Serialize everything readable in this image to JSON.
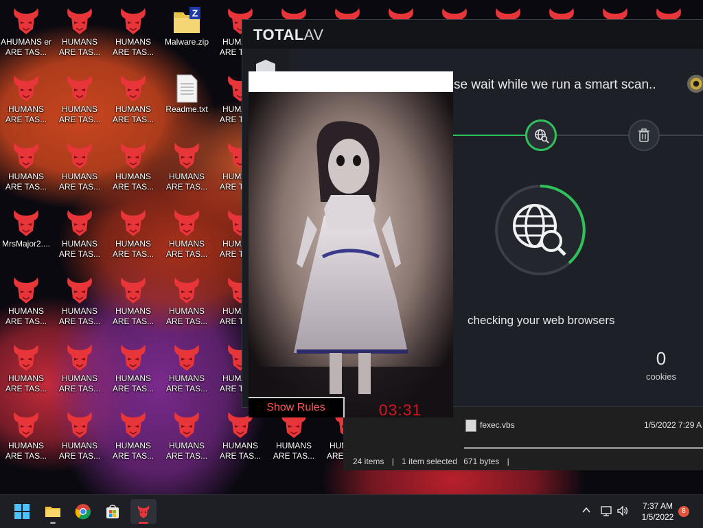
{
  "desktop": {
    "icons": [
      {
        "label": "AHUMANS er ARE TAS...",
        "kind": "demon-overlay"
      },
      {
        "label": "HUMANS ARE TAS...",
        "kind": "demon"
      },
      {
        "label": "HUMANS ARE TAS...",
        "kind": "demon"
      },
      {
        "label": "Malware.zip",
        "kind": "zip"
      },
      {
        "label": "HUMANS ARE TAS...",
        "kind": "demon"
      },
      {
        "label": "HUMANS ARE TAS...",
        "kind": "demon"
      },
      {
        "label": "HUMANS ARE TAS...",
        "kind": "demon"
      },
      {
        "label": "HUMANS ARE TAS...",
        "kind": "demon"
      },
      {
        "label": "Readme.txt",
        "kind": "text"
      },
      {
        "label": "HUMANS ARE TAS...",
        "kind": "demon"
      },
      {
        "label": "HUMANS ARE TAS...",
        "kind": "demon"
      },
      {
        "label": "HUMANS ARE TAS...",
        "kind": "demon"
      },
      {
        "label": "HUMANS ARE TAS...",
        "kind": "demon"
      },
      {
        "label": "HUMANS ARE TAS...",
        "kind": "demon"
      },
      {
        "label": "HUMANS ARE TAS...",
        "kind": "demon"
      },
      {
        "label": "MrsMajor2....",
        "kind": "demon"
      },
      {
        "label": "HUMANS ARE TAS...",
        "kind": "demon"
      },
      {
        "label": "HUMANS ARE TAS...",
        "kind": "demon"
      },
      {
        "label": "HUMANS ARE TAS...",
        "kind": "demon"
      },
      {
        "label": "HUMANS ARE TAS...",
        "kind": "demon"
      },
      {
        "label": "HUMANS ARE TAS...",
        "kind": "demon"
      },
      {
        "label": "HUMANS ARE TAS...",
        "kind": "demon"
      },
      {
        "label": "HUMANS ARE TAS...",
        "kind": "demon"
      },
      {
        "label": "HUMANS ARE TAS...",
        "kind": "demon"
      },
      {
        "label": "HUMANS ARE TAS...",
        "kind": "demon"
      },
      {
        "label": "HUMANS ARE TAS...",
        "kind": "demon"
      },
      {
        "label": "HUMANS ARE TAS...",
        "kind": "demon"
      },
      {
        "label": "HUMANS ARE TAS...",
        "kind": "demon"
      },
      {
        "label": "HUMANS ARE TAS...",
        "kind": "demon"
      },
      {
        "label": "HUMANS ARE TAS...",
        "kind": "demon"
      },
      {
        "label": "HUMANS ARE TAS...",
        "kind": "demon"
      },
      {
        "label": "HUMANS ARE TAS...",
        "kind": "demon"
      },
      {
        "label": "HUMANS ARE TAS...",
        "kind": "demon"
      },
      {
        "label": "HUMANS ARE TAS...",
        "kind": "demon"
      },
      {
        "label": "HUMANS ARE TAS...",
        "kind": "demon"
      },
      {
        "label": "HUMANS ARE TAS...",
        "kind": "demon"
      },
      {
        "label": "HUMANS ARE TAS...",
        "kind": "demon"
      },
      {
        "label": "HUMANS ARE TAS...",
        "kind": "demon"
      },
      {
        "label": "HUMANS ARE TAS...",
        "kind": "demon"
      },
      {
        "label": "HUMANS ARE TAS...",
        "kind": "demon"
      },
      {
        "label": "HUMANS ARE TAS...",
        "kind": "demon"
      },
      {
        "label": "HUM ARE T",
        "kind": "demon"
      }
    ],
    "top_row_extra_count": 8,
    "colors": {
      "demon": "#e8353a",
      "demon_dark": "#7a1016"
    }
  },
  "totalav": {
    "logo_total": "TOTAL",
    "logo_av": "AV",
    "minimize_glyph": "l",
    "message": "se wait while we run a smart scan..",
    "status": "checking your web browsers",
    "count_value": "0",
    "count_label": "cookies",
    "accent": "#2fc25b"
  },
  "prank": {
    "rules_button": "Show Rules",
    "timer": "03:31"
  },
  "explorer": {
    "file_name": "fexec.vbs",
    "file_date": "1/5/2022 7:29 A",
    "items": "24 items",
    "selected": "1 item selected",
    "size": "671 bytes",
    "separator": "|"
  },
  "taskbar": {
    "time": "7:37 AM",
    "date": "1/5/2022",
    "notifications": "8"
  }
}
